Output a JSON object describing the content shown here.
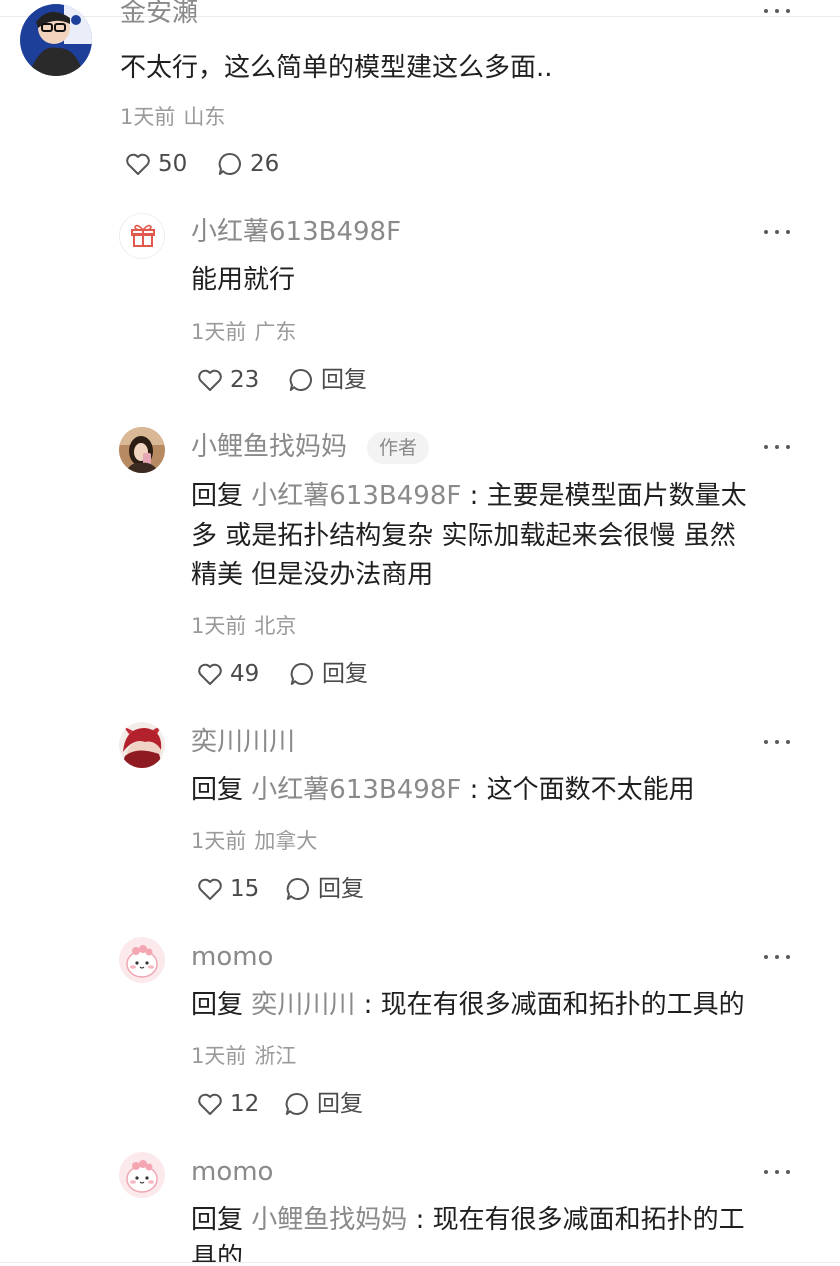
{
  "top_comment": {
    "username": "金安瀬",
    "content": "不太行，这么简单的模型建这么多面..",
    "time": "1天前",
    "location": "山东",
    "likes": "50",
    "replies_count": "26"
  },
  "replies": [
    {
      "username": "小红薯613B498F",
      "avatar_icon": "gift-icon",
      "content_lines": [
        "能用就行"
      ],
      "time": "1天前",
      "location": "广东",
      "likes": "23",
      "reply_label": "回复"
    },
    {
      "username": "小鲤鱼找妈妈",
      "author_tag": "作者",
      "reply_prefix": "回复",
      "reply_to": "小红薯613B498F",
      "colon": ":",
      "content_lines": [
        "主要是模型面片数量太",
        "多 或是拓扑结构复杂 实际加载起来会很慢 虽然",
        "精美 但是没办法商用"
      ],
      "time": "1天前",
      "location": "北京",
      "likes": "49",
      "reply_label": "回复"
    },
    {
      "username": "奕川川川",
      "reply_prefix": "回复",
      "reply_to": "小红薯613B498F",
      "colon": ":",
      "content_lines": [
        "这个面数不太能用"
      ],
      "time": "1天前",
      "location": "加拿大",
      "likes": "15",
      "reply_label": "回复"
    },
    {
      "username": "momo",
      "reply_prefix": "回复",
      "reply_to": "奕川川川",
      "colon": ":",
      "content_lines": [
        "现在有很多减面和拓扑的工具的"
      ],
      "time": "1天前",
      "location": "浙江",
      "likes": "12",
      "reply_label": "回复"
    },
    {
      "username": "momo",
      "reply_prefix": "回复",
      "reply_to": "小鲤鱼找妈妈",
      "colon": ":",
      "content_lines": [
        "现在有很多减面和拓扑的工",
        "具的"
      ]
    }
  ],
  "colors": {
    "muted": "#8a8a8a",
    "text": "#1f1f1f",
    "meta": "#9a9a9a"
  }
}
